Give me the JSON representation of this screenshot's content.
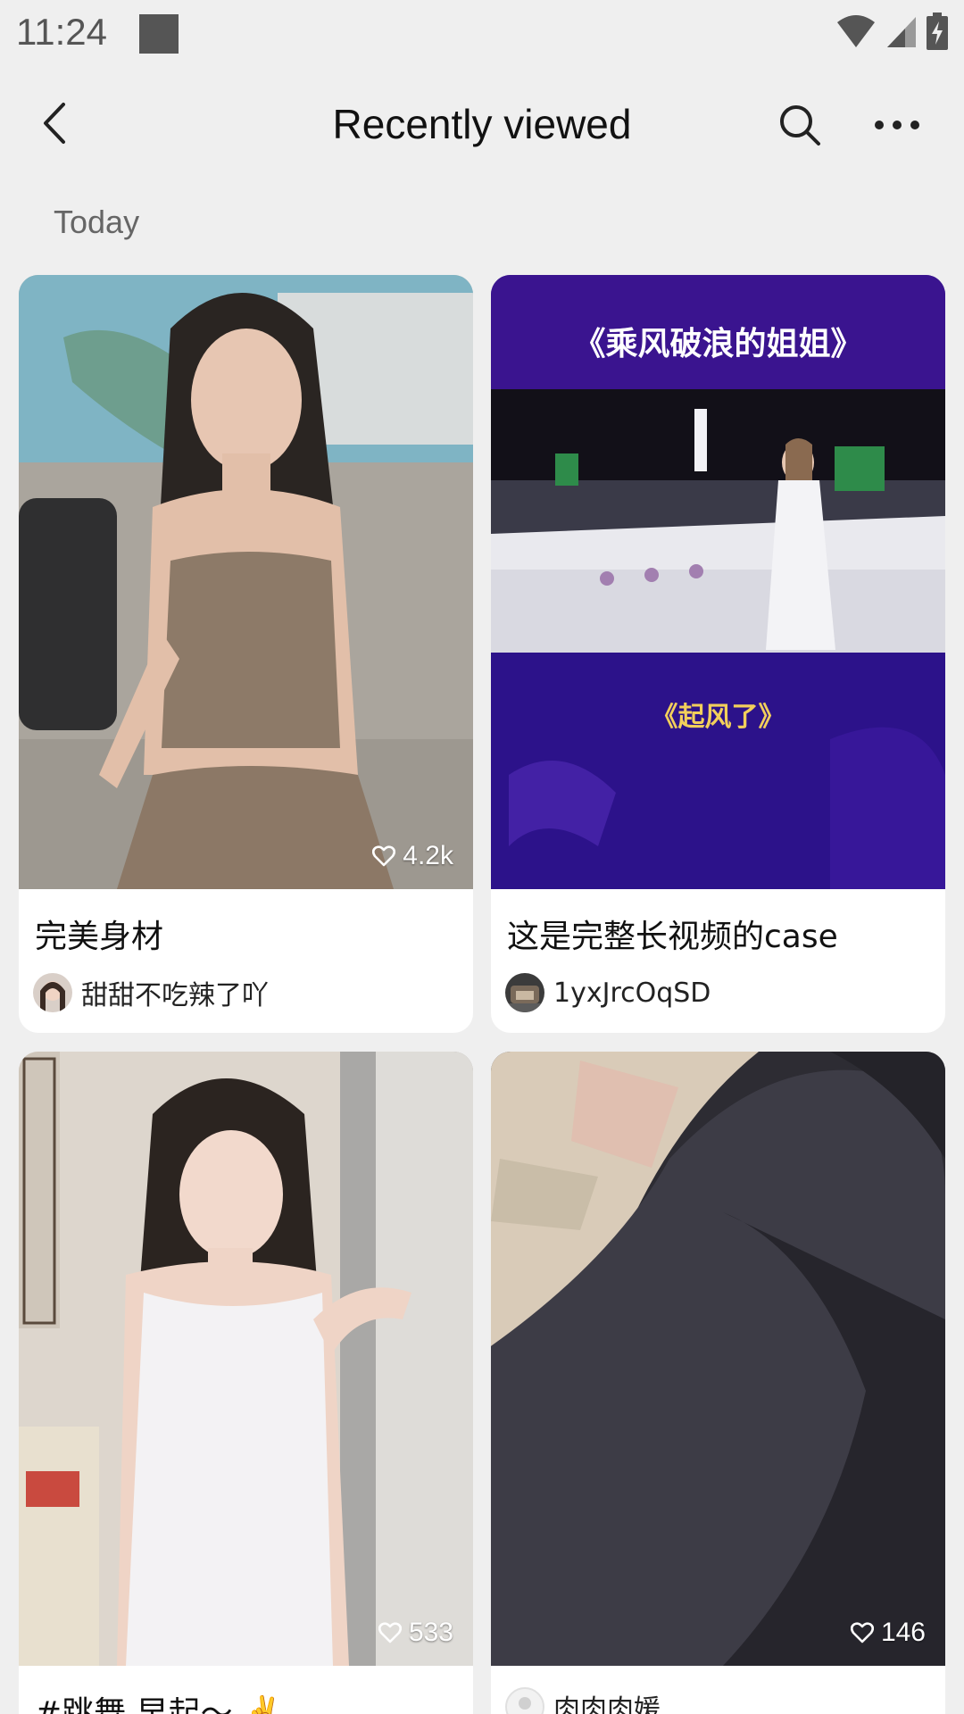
{
  "status_bar": {
    "time": "11:24",
    "icons": [
      "notification-square-icon",
      "wifi-icon",
      "signal-icon",
      "battery-charging-icon"
    ]
  },
  "header": {
    "title": "Recently viewed",
    "icons": [
      "back-icon",
      "search-icon",
      "more-icon"
    ]
  },
  "section": {
    "label": "Today"
  },
  "cards": [
    {
      "title": "完美身材",
      "author": "甜甜不吃辣了吖",
      "likes": "4.2k"
    },
    {
      "title": "这是完整长视频的case",
      "author": "1yxJrcOqSD",
      "likes": "",
      "overlay_top": "《乘风破浪的姐姐》",
      "overlay_bottom": "《起风了》"
    },
    {
      "title": "#跳舞 早起～ ✌️",
      "author": "",
      "likes": "533"
    },
    {
      "title": "",
      "author": "肉肉肉媛",
      "likes": "146"
    }
  ],
  "colors": {
    "background": "#efefef",
    "card": "#ffffff",
    "text": "#111111",
    "muted": "#666666"
  }
}
